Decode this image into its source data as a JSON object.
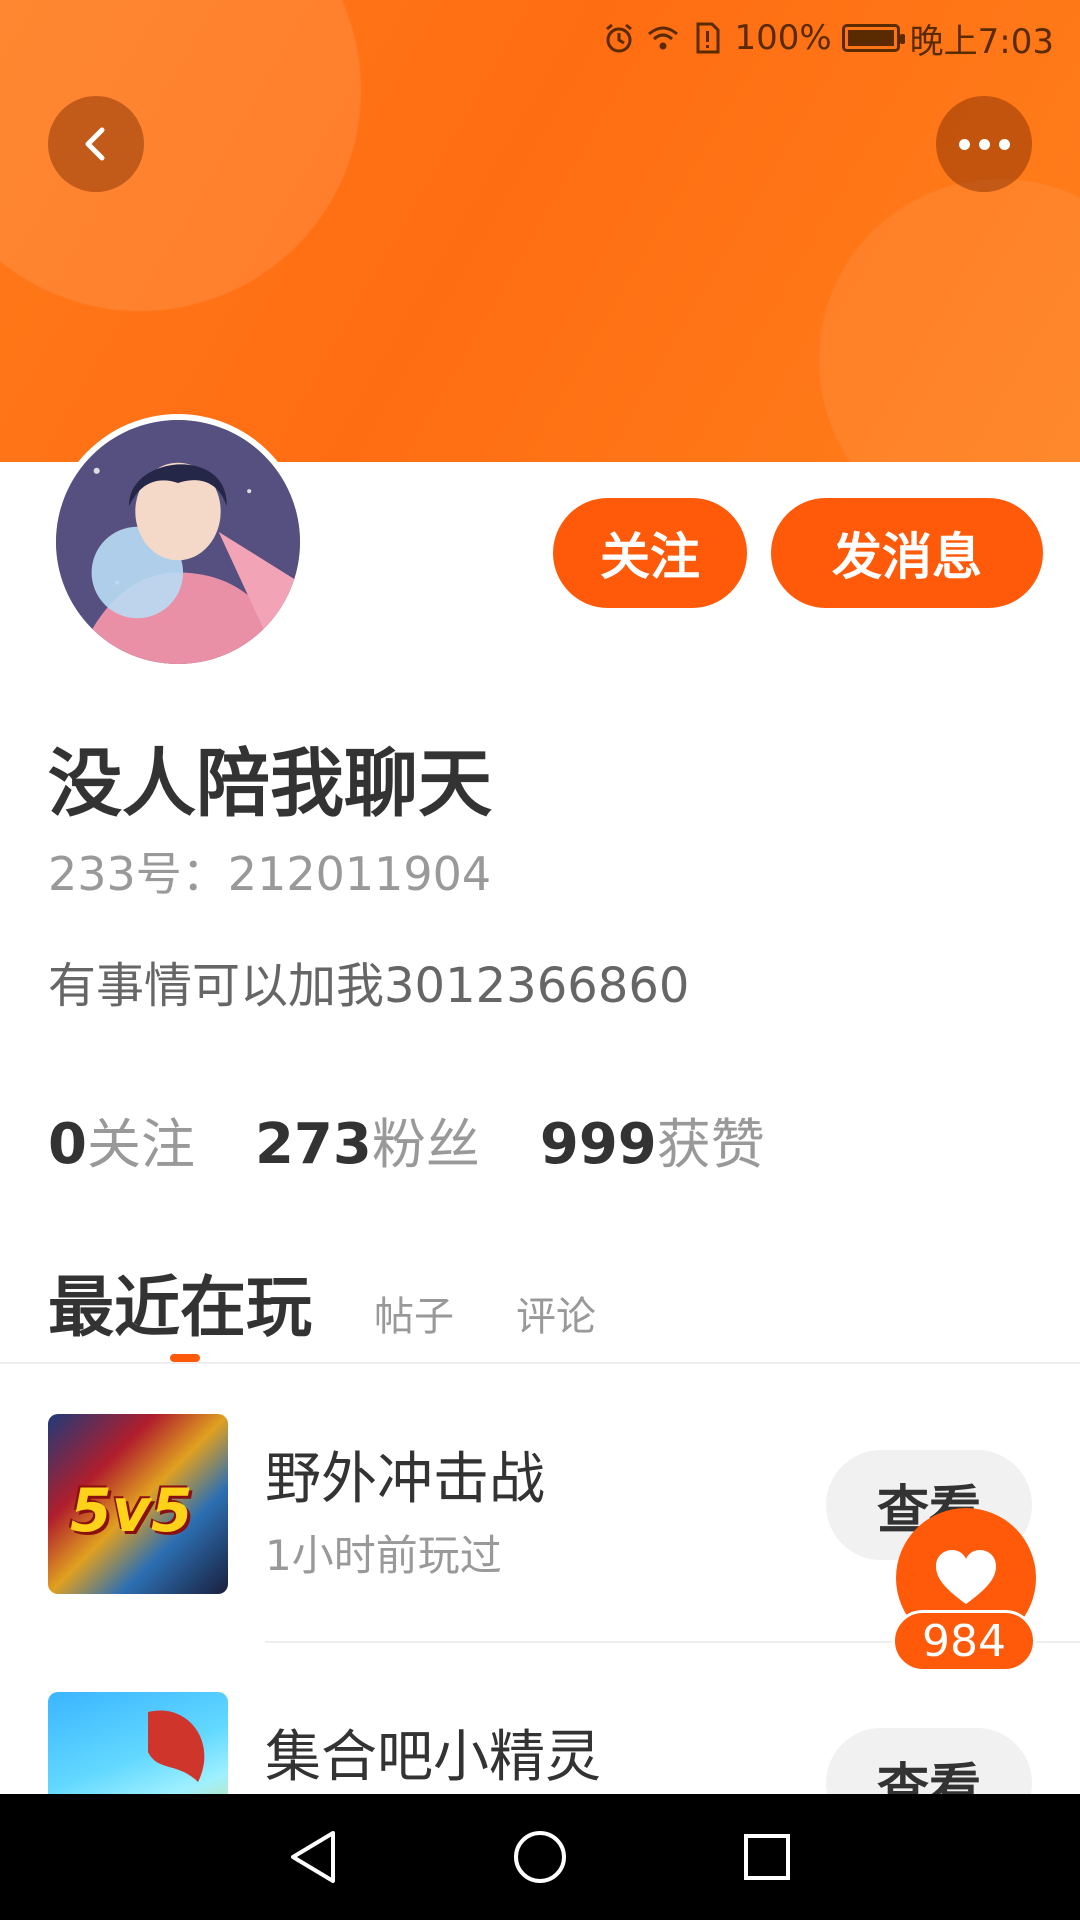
{
  "status_bar": {
    "battery_text": "100%",
    "time": "晚上7:03",
    "icons": [
      "alarm-icon",
      "wifi-icon",
      "sim-alert-icon",
      "battery-icon"
    ]
  },
  "header": {
    "back_icon": "chevron-left-icon",
    "more_icon": "more-dots-icon",
    "banner_color": "#ff7a1a"
  },
  "actions": {
    "follow_label": "关注",
    "message_label": "发消息",
    "accent": "#ff5a0a"
  },
  "profile": {
    "name": "没人陪我聊天",
    "id_line": "233号：212011904",
    "bio": "有事情可以加我3012366860"
  },
  "stats": [
    {
      "num": "0",
      "label": "关注"
    },
    {
      "num": "273",
      "label": "粉丝"
    },
    {
      "num": "999",
      "label": "获赞"
    }
  ],
  "tabs": [
    {
      "label": "最近在玩",
      "active": true
    },
    {
      "label": "帖子",
      "active": false
    },
    {
      "label": "评论",
      "active": false
    }
  ],
  "games": [
    {
      "title": "野外冲击战",
      "subtitle": "1小时前玩过",
      "view_label": "查看",
      "thumb_text": "5v5"
    },
    {
      "title": "集合吧小精灵",
      "subtitle": "",
      "view_label": "查看"
    }
  ],
  "like_float": {
    "count": "984",
    "icon": "heart-icon"
  },
  "navigation": [
    "back-triangle-icon",
    "home-circle-icon",
    "recents-square-icon"
  ]
}
